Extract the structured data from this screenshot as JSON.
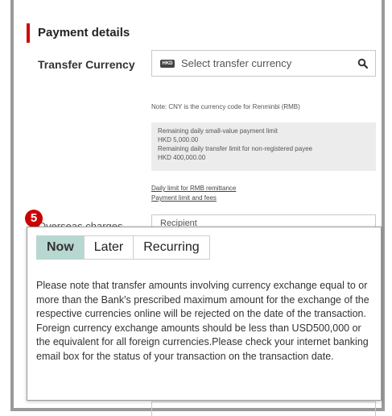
{
  "section": {
    "title": "Payment details"
  },
  "transfer_currency": {
    "label": "Transfer Currency",
    "currency_icon_text": "HKD",
    "placeholder": "Select transfer currency"
  },
  "note": "Note: CNY is the currency code for Renminbi (RMB)",
  "limits": {
    "daily_small_value_label": "Remaining daily small-value payment limit",
    "daily_small_value_amount": "HKD 5,000.00",
    "daily_transfer_label": "Remaining daily transfer limit for non-registered payee",
    "daily_transfer_amount": "HKD 400,000.00"
  },
  "links": {
    "daily_limit_rmb": "Daily limit for RMB remittance",
    "payment_limit_fees": "Payment limit and fees"
  },
  "step_badge": "5",
  "overseas_charges": {
    "label": "Overseas charges",
    "value": "Recipient"
  },
  "tooltip": {
    "tabs": [
      {
        "label": "Now"
      },
      {
        "label": "Later"
      },
      {
        "label": "Recurring"
      }
    ],
    "active_tab": "Now",
    "message": "Please note that transfer amounts involving currency exchange equal to or more than the Bank's prescribed maximum amount for the exchange of the respective currencies online will be rejected on the date of the transaction. Foreign currency exchange amounts should be less than USD500,000 or the equivalent for all foreign currencies.Please check your internet banking email box for the status of your transaction on the transaction date."
  },
  "colors": {
    "accent_red": "#d40000",
    "badge_red": "#cc0000",
    "active_tab_bg": "#b7d7d0",
    "limits_bg": "#ececec"
  }
}
